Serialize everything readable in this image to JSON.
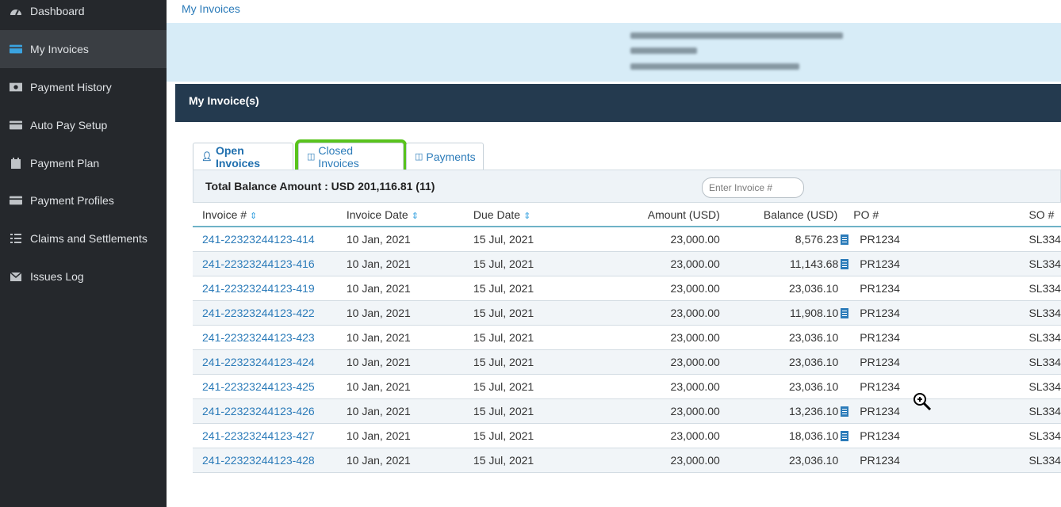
{
  "sidebar": {
    "items": [
      {
        "label": "Dashboard",
        "icon": "dashboard-icon"
      },
      {
        "label": "My Invoices",
        "icon": "invoice-icon",
        "active": true
      },
      {
        "label": "Payment History",
        "icon": "cash-icon"
      },
      {
        "label": "Auto Pay Setup",
        "icon": "credit-card-icon"
      },
      {
        "label": "Payment Plan",
        "icon": "calendar-icon"
      },
      {
        "label": "Payment Profiles",
        "icon": "credit-card-icon"
      },
      {
        "label": "Claims and Settlements",
        "icon": "list-icon"
      },
      {
        "label": "Issues Log",
        "icon": "envelope-icon"
      }
    ]
  },
  "breadcrumb": "My Invoices",
  "panel_title": "My Invoice(s)",
  "tabs": [
    {
      "label": "Open Invoices",
      "icon": "user-icon"
    },
    {
      "label": "Closed Invoices",
      "icon": "window-icon"
    },
    {
      "label": "Payments",
      "icon": "window-icon"
    }
  ],
  "balance_summary": "Total Balance Amount : USD 201,116.81 (11)",
  "search": {
    "placeholder": "Enter Invoice #",
    "value": ""
  },
  "table": {
    "headers": [
      "Invoice #",
      "Invoice Date",
      "Due Date",
      "Amount (USD)",
      "Balance (USD)",
      "PO #",
      "SO #"
    ],
    "rows": [
      {
        "invoice": "241-22323244123-414",
        "invoice_date": "10 Jan, 2021",
        "due_date": "15 Jul, 2021",
        "amount": "23,000.00",
        "balance": "8,576.23",
        "doc": true,
        "po": "PR1234",
        "so": "SL334"
      },
      {
        "invoice": "241-22323244123-416",
        "invoice_date": "10 Jan, 2021",
        "due_date": "15 Jul, 2021",
        "amount": "23,000.00",
        "balance": "11,143.68",
        "doc": true,
        "po": "PR1234",
        "so": "SL334"
      },
      {
        "invoice": "241-22323244123-419",
        "invoice_date": "10 Jan, 2021",
        "due_date": "15 Jul, 2021",
        "amount": "23,000.00",
        "balance": "23,036.10",
        "doc": false,
        "po": "PR1234",
        "so": "SL334"
      },
      {
        "invoice": "241-22323244123-422",
        "invoice_date": "10 Jan, 2021",
        "due_date": "15 Jul, 2021",
        "amount": "23,000.00",
        "balance": "11,908.10",
        "doc": true,
        "po": "PR1234",
        "so": "SL334"
      },
      {
        "invoice": "241-22323244123-423",
        "invoice_date": "10 Jan, 2021",
        "due_date": "15 Jul, 2021",
        "amount": "23,000.00",
        "balance": "23,036.10",
        "doc": false,
        "po": "PR1234",
        "so": "SL334"
      },
      {
        "invoice": "241-22323244123-424",
        "invoice_date": "10 Jan, 2021",
        "due_date": "15 Jul, 2021",
        "amount": "23,000.00",
        "balance": "23,036.10",
        "doc": false,
        "po": "PR1234",
        "so": "SL334"
      },
      {
        "invoice": "241-22323244123-425",
        "invoice_date": "10 Jan, 2021",
        "due_date": "15 Jul, 2021",
        "amount": "23,000.00",
        "balance": "23,036.10",
        "doc": false,
        "po": "PR1234",
        "so": "SL334"
      },
      {
        "invoice": "241-22323244123-426",
        "invoice_date": "10 Jan, 2021",
        "due_date": "15 Jul, 2021",
        "amount": "23,000.00",
        "balance": "13,236.10",
        "doc": true,
        "po": "PR1234",
        "so": "SL334"
      },
      {
        "invoice": "241-22323244123-427",
        "invoice_date": "10 Jan, 2021",
        "due_date": "15 Jul, 2021",
        "amount": "23,000.00",
        "balance": "18,036.10",
        "doc": true,
        "po": "PR1234",
        "so": "SL334"
      },
      {
        "invoice": "241-22323244123-428",
        "invoice_date": "10 Jan, 2021",
        "due_date": "15 Jul, 2021",
        "amount": "23,000.00",
        "balance": "23,036.10",
        "doc": false,
        "po": "PR1234",
        "so": "SL334"
      }
    ]
  },
  "colors": {
    "sidebar_bg": "#25282c",
    "panel_header_bg": "#243a4f",
    "link": "#2b7bb9",
    "highlight": "#59c31d",
    "info_band": "#d7ecf7"
  }
}
